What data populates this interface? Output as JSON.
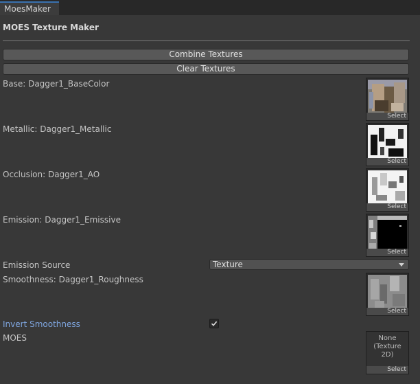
{
  "window": {
    "tab_label": "MoesMaker"
  },
  "header": {
    "title": "MOES Texture Maker"
  },
  "buttons": {
    "combine": "Combine Textures",
    "clear": "Clear Textures"
  },
  "fields": {
    "base": {
      "label": "Base: Dagger1_BaseColor",
      "select": "Select"
    },
    "metallic": {
      "label": "Metallic: Dagger1_Metallic",
      "select": "Select"
    },
    "occlusion": {
      "label": "Occlusion: Dagger1_AO",
      "select": "Select"
    },
    "emission": {
      "label": "Emission: Dagger1_Emissive",
      "select": "Select"
    },
    "emission_source": {
      "label": "Emission Source",
      "value": "Texture"
    },
    "smoothness": {
      "label": "Smoothness: Dagger1_Roughness",
      "select": "Select"
    },
    "invert_smoothness": {
      "label": "Invert Smoothness",
      "checked": true
    },
    "moes": {
      "label": "MOES",
      "value_line1": "None",
      "value_line2": "(Texture 2D)",
      "select": "Select"
    }
  },
  "colors": {
    "accent_tab": "#3a72b0",
    "highlight_label": "#7fa6e0",
    "background": "#383838"
  }
}
